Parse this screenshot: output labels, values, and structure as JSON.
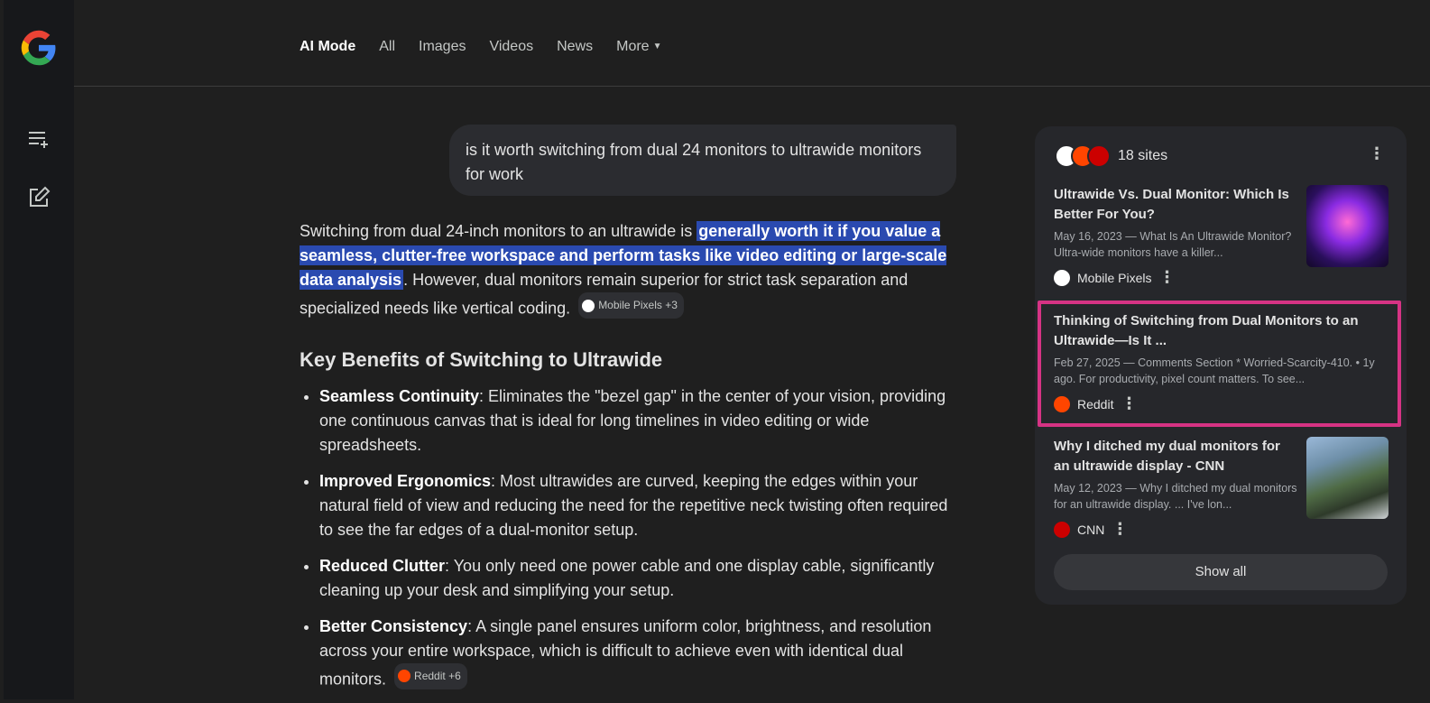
{
  "rail": {
    "logo": "google-g-logo",
    "icons": [
      "new-thread-icon",
      "edit-icon"
    ]
  },
  "nav": {
    "tabs": [
      {
        "label": "AI Mode",
        "active": true
      },
      {
        "label": "All"
      },
      {
        "label": "Images"
      },
      {
        "label": "Videos"
      },
      {
        "label": "News"
      },
      {
        "label": "More"
      }
    ]
  },
  "query": "is it worth switching from dual 24 monitors to ultrawide monitors for work",
  "answer": {
    "intro_pre": "Switching from dual 24-inch monitors to an ultrawide is ",
    "intro_highlight": "generally worth it if you value a seamless, clutter-free workspace and perform tasks like video editing or large-scale data analysis",
    "intro_post": ". However, dual monitors remain superior for strict task separation and specialized needs like vertical coding.",
    "intro_chip": "Mobile Pixels +3",
    "heading": "Key Benefits of Switching to Ultrawide",
    "bullets": [
      {
        "bold": "Seamless Continuity",
        "text": ": Eliminates the \"bezel gap\" in the center of your vision, providing one continuous canvas that is ideal for long timelines in video editing or wide spreadsheets."
      },
      {
        "bold": "Improved Ergonomics",
        "text": ": Most ultrawides are curved, keeping the edges within your natural field of view and reducing the need for the repetitive neck twisting often required to see the far edges of a dual-monitor setup."
      },
      {
        "bold": "Reduced Clutter",
        "text": ": You only need one power cable and one display cable, significantly cleaning up your desk and simplifying your setup."
      },
      {
        "bold": "Better Consistency",
        "text": ": A single panel ensures uniform color, brightness, and resolution across your entire workspace, which is difficult to achieve even with identical dual monitors."
      }
    ],
    "bullet_chip": "Reddit +6"
  },
  "panel": {
    "sites_label": "18 sites",
    "cards": [
      {
        "title": "Ultrawide Vs. Dual Monitor: Which Is Better For You?",
        "snippet": "May 16, 2023 — What Is An Ultrawide Monitor? Ultra-wide monitors have a killer...",
        "source": "Mobile Pixels"
      },
      {
        "title": "Thinking of Switching from Dual Monitors to an Ultrawide—Is It ...",
        "snippet": "Feb 27, 2025 — Comments Section * Worried-Scarcity-410. • 1y ago. For productivity, pixel count matters. To see...",
        "source": "Reddit"
      },
      {
        "title": "Why I ditched my dual monitors for an ultrawide display - CNN",
        "snippet": "May 12, 2023 — Why I ditched my dual monitors for an ultrawide display. ... I've lon...",
        "source": "CNN"
      }
    ],
    "show_all": "Show all"
  },
  "colors": {
    "highlight": "#2a4ab0",
    "focus_box": "#d63384",
    "background": "#1f1f1f"
  }
}
